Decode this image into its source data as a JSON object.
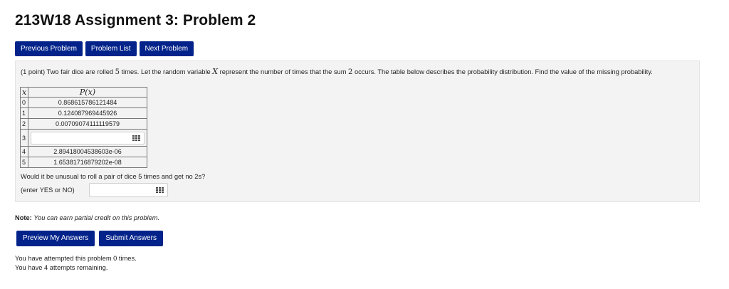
{
  "page": {
    "title": "213W18 Assignment 3: Problem 2"
  },
  "nav": {
    "previous": "Previous Problem",
    "list": "Problem List",
    "next": "Next Problem"
  },
  "problem": {
    "points": "(1 point)",
    "text_a": " Two fair dice are rolled ",
    "n_rolls": "5",
    "text_b": " times. Let the random variable ",
    "var": "X",
    "text_c": " represent the number of times that the sum ",
    "sum_value": "2",
    "text_d": " occurs. The table below describes the probability distribution. Find the value of the missing probability.",
    "table": {
      "header_x": "x",
      "header_p": "P(x)",
      "rows": [
        {
          "x": "0",
          "p": "0.868615786121484"
        },
        {
          "x": "1",
          "p": "0.124087969445926"
        },
        {
          "x": "2",
          "p": "0.00709074111119579"
        },
        {
          "x": "3",
          "p": ""
        },
        {
          "x": "4",
          "p": "2.89418004538603e-06"
        },
        {
          "x": "5",
          "p": "1.65381716879202e-08"
        }
      ],
      "missing_input_value": ""
    },
    "question": "Would it be unusual to roll a pair of dice 5 times and get no 2s?",
    "yesno_label": "(enter YES or NO)",
    "yesno_value": ""
  },
  "note": {
    "label": "Note:",
    "text": "You can earn partial credit on this problem."
  },
  "actions": {
    "preview": "Preview My Answers",
    "submit": "Submit Answers"
  },
  "attempts": {
    "line1": "You have attempted this problem 0 times.",
    "line2": "You have 4 attempts remaining."
  },
  "colors": {
    "button_bg": "#03238b",
    "panel_bg": "#f3f3f3"
  },
  "icons": {
    "equation_editor": "grid-icon"
  }
}
